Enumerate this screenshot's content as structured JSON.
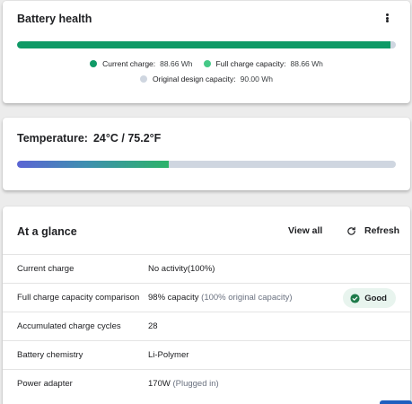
{
  "battery_health": {
    "title": "Battery health",
    "bar_fill_fraction": 0.985,
    "legend": [
      {
        "label": "Current charge:",
        "value": "88.66 Wh",
        "color": "#0f9a66"
      },
      {
        "label": "Full charge capacity:",
        "value": "88.66 Wh",
        "color": "#45c987"
      },
      {
        "label": "Original design capacity:",
        "value": "90.00 Wh",
        "color": "#cfd6e0"
      }
    ],
    "menu_icon": "more-vertical-icon"
  },
  "temperature": {
    "label": "Temperature:",
    "value": "24°C / 75.2°F",
    "bar_fill_fraction": 0.4
  },
  "at_a_glance": {
    "title": "At a glance",
    "view_all": "View all",
    "refresh": "Refresh",
    "refresh_icon": "refresh-icon",
    "rows": [
      {
        "label": "Current charge",
        "value": "No activity(100%)",
        "sub": ""
      },
      {
        "label": "Full charge capacity comparison",
        "value": "98% capacity",
        "sub": "(100% original capacity)",
        "badge": "Good"
      },
      {
        "label": "Accumulated charge cycles",
        "value": "28",
        "sub": ""
      },
      {
        "label": "Battery chemistry",
        "value": "Li-Polymer",
        "sub": ""
      },
      {
        "label": "Power adapter",
        "value": "170W",
        "sub": "(Plugged in)"
      }
    ],
    "good_color": "#e8f4ee",
    "check_color": "#1e7a4a"
  }
}
